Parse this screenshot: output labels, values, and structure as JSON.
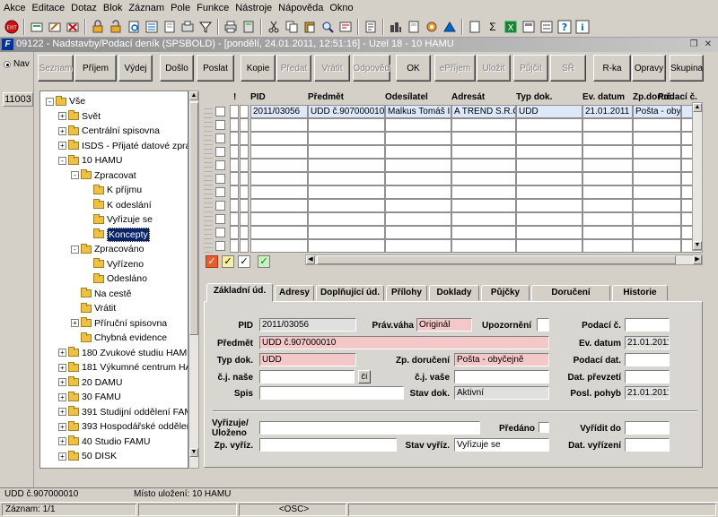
{
  "menu": [
    "Akce",
    "Editace",
    "Dotaz",
    "Blok",
    "Záznam",
    "Pole",
    "Funkce",
    "Nástroje",
    "Nápověda",
    "Okno"
  ],
  "toolbar_icons": [
    "exit-icon",
    "add-icon",
    "edit-icon",
    "delete-icon",
    "lock-icon",
    "unlock-icon",
    "print-preview-icon",
    "filter-icon",
    "printer-icon",
    "list-icon",
    "cut-icon",
    "copy-icon",
    "paste-icon",
    "search-icon",
    "attach-icon",
    "calculator-icon",
    "settings-icon",
    "triangle-icon",
    "document-icon",
    "sum-icon",
    "excel-icon",
    "form-icon",
    "database-icon",
    "help-icon",
    "info-icon"
  ],
  "title": {
    "logo": "F",
    "text": "09122 - Nadstavby/Podací deník (SPSBOLD) - [pondělí, 24.01.2011, 12:51:16] - Uzel 18 - 10 HAMU"
  },
  "nav": {
    "label": "Nav",
    "id_button": "11003"
  },
  "buttons": [
    {
      "label": "Seznam",
      "disabled": true
    },
    {
      "label": "Příjem",
      "disabled": false
    },
    {
      "label": "Výdej",
      "disabled": false
    },
    {
      "label": "Došlo",
      "disabled": false
    },
    {
      "label": "Poslat",
      "disabled": false
    },
    {
      "label": "Kopie",
      "disabled": false
    },
    {
      "label": "Předat",
      "disabled": true
    },
    {
      "label": "Vrátit",
      "disabled": true
    },
    {
      "label": "Odpověď",
      "disabled": true
    },
    {
      "label": "OK",
      "disabled": false
    },
    {
      "label": "ePříjem",
      "disabled": true
    },
    {
      "label": "Uložit",
      "disabled": true
    },
    {
      "label": "Půjčit",
      "disabled": true
    },
    {
      "label": "SŘ",
      "disabled": true
    },
    {
      "label": "R-ka",
      "disabled": false
    },
    {
      "label": "Opravy",
      "disabled": false
    },
    {
      "label": "Skupina",
      "disabled": false
    }
  ],
  "tree": [
    {
      "label": "Vše",
      "level": 0,
      "exp": "-"
    },
    {
      "label": "Svět",
      "level": 1,
      "exp": "+"
    },
    {
      "label": "Centrální spisovna",
      "level": 1,
      "exp": "+"
    },
    {
      "label": "ISDS - Přijaté datové zprávy",
      "level": 1,
      "exp": "+"
    },
    {
      "label": "10 HAMU",
      "level": 1,
      "exp": "-"
    },
    {
      "label": "Zpracovat",
      "level": 2,
      "exp": "-"
    },
    {
      "label": "K příjmu",
      "level": 3,
      "exp": ""
    },
    {
      "label": "K odeslání",
      "level": 3,
      "exp": ""
    },
    {
      "label": "Vyřizuje se",
      "level": 3,
      "exp": ""
    },
    {
      "label": "Koncepty",
      "level": 3,
      "exp": "",
      "selected": true
    },
    {
      "label": "Zpracováno",
      "level": 2,
      "exp": "-"
    },
    {
      "label": "Vyřízeno",
      "level": 3,
      "exp": ""
    },
    {
      "label": "Odesláno",
      "level": 3,
      "exp": ""
    },
    {
      "label": "Na cestě",
      "level": 2,
      "exp": ""
    },
    {
      "label": "Vrátit",
      "level": 2,
      "exp": ""
    },
    {
      "label": "Příruční spisovna",
      "level": 2,
      "exp": "+"
    },
    {
      "label": "Chybná evidence",
      "level": 2,
      "exp": ""
    },
    {
      "label": "180 Zvukové studiu HAMU",
      "level": 1,
      "exp": "+"
    },
    {
      "label": "181 Výkumné centrum HAMU",
      "level": 1,
      "exp": "+"
    },
    {
      "label": "20 DAMU",
      "level": 1,
      "exp": "+"
    },
    {
      "label": "30 FAMU",
      "level": 1,
      "exp": "+"
    },
    {
      "label": "391 Studijní oddělení FAMU",
      "level": 1,
      "exp": "+"
    },
    {
      "label": "393 Hospodářské oddělení FAMU",
      "level": 1,
      "exp": "+"
    },
    {
      "label": "40 Studio FAMU",
      "level": 1,
      "exp": "+"
    },
    {
      "label": "50 DISK",
      "level": 1,
      "exp": "+"
    }
  ],
  "grid": {
    "headers": [
      "!",
      "PID",
      "Předmět",
      "Odesílatel",
      "Adresát",
      "Typ dok.",
      "Ev. datum",
      "Zp.doruč.",
      "Podací č."
    ],
    "row": [
      "2011/03056",
      "UDD č.907000010",
      "Malkus Tomáš Ing.",
      "A TREND S.R.O.",
      "UDD",
      "21.01.2011",
      "Pošta - obyče",
      ""
    ]
  },
  "tabs": [
    "Základní úd.",
    "Adresy",
    "Doplňující úd.",
    "Přílohy",
    "Doklady",
    "Půjčky",
    "Doručení",
    "Historie"
  ],
  "form": {
    "pid_label": "PID",
    "pid": "2011/03056",
    "pravvaha_label": "Práv.váha",
    "pravvaha": "Originál",
    "upozorneni_label": "Upozornění",
    "podacic_label": "Podací č.",
    "podacic": "",
    "predmet_label": "Předmět",
    "predmet": "UDD č.907000010",
    "evdatum_label": "Ev. datum",
    "evdatum": "21.01.2011",
    "typdok_label": "Typ dok.",
    "typdok": "UDD",
    "zpdoruceni_label": "Zp. doručení",
    "zpdoruceni": "Pošta - obyčejně",
    "podacidat_label": "Podací dat.",
    "podacidat": "",
    "cjnase_label": "č.j. naše",
    "cjnase": "",
    "ci_btn": "čí",
    "cjvase_label": "č.j. vaše",
    "cjvase": "",
    "datprevzeti_label": "Dat. převzetí",
    "datprevzeti": "",
    "spis_label": "Spis",
    "spis": "",
    "stavdok_label": "Stav dok.",
    "stavdok": "Aktivní",
    "poslpohyb_label": "Posl. pohyb",
    "poslpohyb": "21.01.2011",
    "vyrizuje_label": "Vyřizuje/ Uloženo",
    "vyrizuje": "",
    "predano_label": "Předáno",
    "vyriditdo_label": "Vyřídit do",
    "vyriditdo": "",
    "zpvyriz_label": "Zp. vyříz.",
    "zpvyriz": "",
    "stavvyriz_label": "Stav vyříz.",
    "stavvyriz": "Vyřizuje se",
    "datvyrizeni_label": "Dat. vyřízení",
    "datvyrizeni": ""
  },
  "status": {
    "left": "UDD č.907000010",
    "location": "Místo uložení: 10 HAMU",
    "record": "Záznam: 1/1",
    "mode": "<OSC>"
  }
}
